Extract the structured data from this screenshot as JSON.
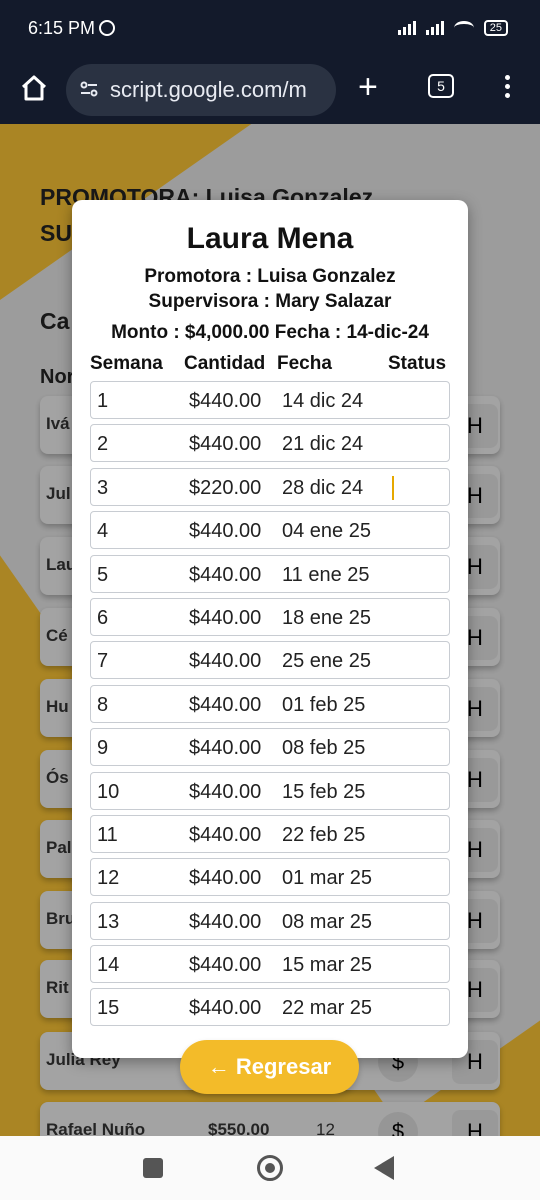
{
  "status": {
    "time": "6:15 PM",
    "battery": "25"
  },
  "browser": {
    "url": "script.google.com/m",
    "tab_count": "5"
  },
  "background": {
    "heading_line1": "PROMOTORA: Luisa Gonzalez",
    "heading_line2": "SU",
    "section_label": "Ca",
    "col_label": "Nor",
    "rows": [
      {
        "name": "Ivá"
      },
      {
        "name": "Jul"
      },
      {
        "name": "Lau"
      },
      {
        "name": "Cé"
      },
      {
        "name": "Hu"
      },
      {
        "name": "Ós"
      },
      {
        "name": "Pal"
      },
      {
        "name": "Bru"
      },
      {
        "name": "Rit"
      },
      {
        "name": "Julia Rey"
      },
      {
        "name": "Rafael Nuño",
        "amount": "$550.00",
        "weeks": "12"
      }
    ],
    "dollar_symbol": "$",
    "h_symbol": "H"
  },
  "modal": {
    "title": "Laura Mena",
    "promotora": "Promotora : Luisa Gonzalez",
    "supervisora": "Supervisora : Mary Salazar",
    "monto": "Monto : $4,000.00 Fecha : 14-dic-24",
    "headers": {
      "semana": "Semana",
      "cantidad": "Cantidad",
      "fecha": "Fecha",
      "status": "Status"
    },
    "payments": [
      {
        "n": "1",
        "amount": "$440.00",
        "date": "14 dic 24"
      },
      {
        "n": "2",
        "amount": "$440.00",
        "date": "21 dic 24"
      },
      {
        "n": "3",
        "amount": "$220.00",
        "date": "28 dic 24"
      },
      {
        "n": "4",
        "amount": "$440.00",
        "date": "04 ene 25"
      },
      {
        "n": "5",
        "amount": "$440.00",
        "date": "11 ene 25"
      },
      {
        "n": "6",
        "amount": "$440.00",
        "date": "18 ene 25"
      },
      {
        "n": "7",
        "amount": "$440.00",
        "date": "25 ene 25"
      },
      {
        "n": "8",
        "amount": "$440.00",
        "date": "01 feb 25"
      },
      {
        "n": "9",
        "amount": "$440.00",
        "date": "08 feb 25"
      },
      {
        "n": "10",
        "amount": "$440.00",
        "date": "15 feb 25"
      },
      {
        "n": "11",
        "amount": "$440.00",
        "date": "22 feb 25"
      },
      {
        "n": "12",
        "amount": "$440.00",
        "date": "01 mar 25"
      },
      {
        "n": "13",
        "amount": "$440.00",
        "date": "08 mar 25"
      },
      {
        "n": "14",
        "amount": "$440.00",
        "date": "15 mar 25"
      },
      {
        "n": "15",
        "amount": "$440.00",
        "date": "22 mar 25"
      }
    ],
    "back_label": "← Regresar"
  }
}
